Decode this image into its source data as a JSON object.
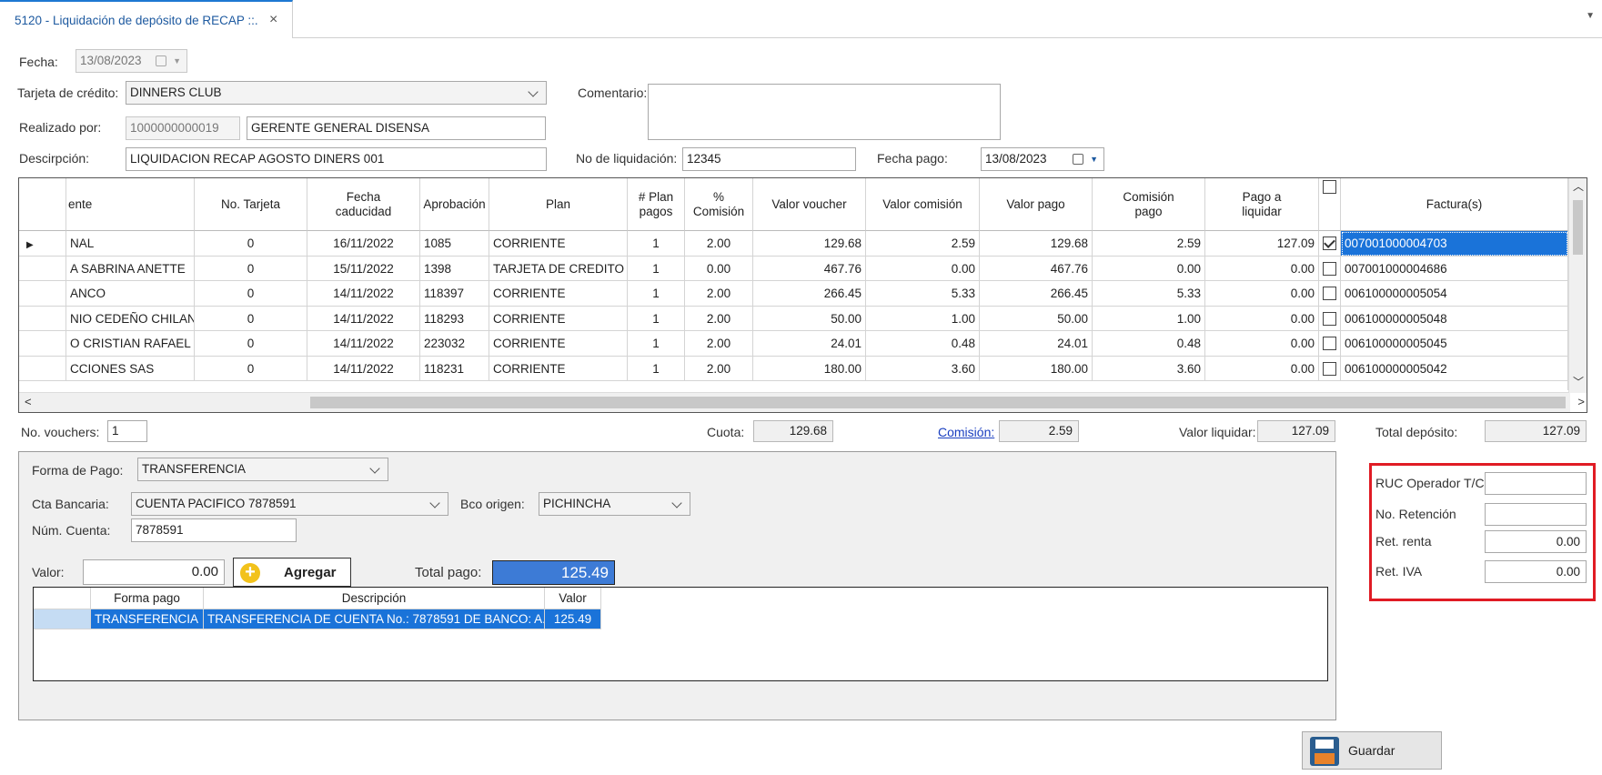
{
  "tab": {
    "title": "5120 - Liquidación de depósito de RECAP ::.",
    "close": "×",
    "menu": "▼"
  },
  "form": {
    "fecha_label": "Fecha:",
    "fecha_value": "13/08/2023",
    "tarjeta_label": "Tarjeta de crédito:",
    "tarjeta_value": "DINNERS CLUB",
    "comentario_label": "Comentario:",
    "comentario_value": "",
    "realizado_label": "Realizado por:",
    "realizado_code": "1000000000019",
    "realizado_name": "GERENTE GENERAL DISENSA",
    "descripcion_label": "Descirpción:",
    "descripcion_value": "LIQUIDACION RECAP AGOSTO DINERS 001",
    "liquidacion_label": "No de liquidación:",
    "liquidacion_value": "12345",
    "fecha_pago_label": "Fecha pago:",
    "fecha_pago_value": "13/08/2023"
  },
  "grid": {
    "headers": [
      "ente",
      "No. Tarjeta",
      "Fecha\ncaducidad",
      "Aprobación",
      "Plan",
      "# Plan\npagos",
      "%\nComisión",
      "Valor voucher",
      "Valor comisión",
      "Valor pago",
      "Comisión\npago",
      "Pago a\nliquidar",
      "",
      "Factura(s)"
    ],
    "rows": [
      [
        "NAL",
        "0",
        "16/11/2022",
        "1085",
        "CORRIENTE",
        "1",
        "2.00",
        "129.68",
        "2.59",
        "129.68",
        "2.59",
        "127.09",
        "007001000004703"
      ],
      [
        "A SABRINA  ANETTE",
        "0",
        "15/11/2022",
        "1398",
        "TARJETA DE CREDITO",
        "1",
        "0.00",
        "467.76",
        "0.00",
        "467.76",
        "0.00",
        "0.00",
        "007001000004686"
      ],
      [
        "ANCO",
        "0",
        "14/11/2022",
        "118397",
        "CORRIENTE",
        "1",
        "2.00",
        "266.45",
        "5.33",
        "266.45",
        "5.33",
        "0.00",
        "006100000005054"
      ],
      [
        "NIO CEDEÑO CHILAN",
        "0",
        "14/11/2022",
        "118293",
        "CORRIENTE",
        "1",
        "2.00",
        "50.00",
        "1.00",
        "50.00",
        "1.00",
        "0.00",
        "006100000005048"
      ],
      [
        "O CRISTIAN RAFAEL",
        "0",
        "14/11/2022",
        "223032",
        "CORRIENTE",
        "1",
        "2.00",
        "24.01",
        "0.48",
        "24.01",
        "0.48",
        "0.00",
        "006100000005045"
      ],
      [
        "CCIONES SAS",
        "0",
        "14/11/2022",
        "118231",
        "CORRIENTE",
        "1",
        "2.00",
        "180.00",
        "3.60",
        "180.00",
        "3.60",
        "0.00",
        "006100000005042"
      ]
    ],
    "checked": [
      true,
      false,
      false,
      false,
      false,
      false
    ],
    "selected_row": 0
  },
  "totals": {
    "vouchers_label": "No. vouchers:",
    "vouchers_value": "1",
    "cuota_label": "Cuota:",
    "cuota_value": "129.68",
    "comision_label": "Comisión:",
    "comision_value": "2.59",
    "valor_liquidar_label": "Valor liquidar:",
    "valor_liquidar_value": "127.09",
    "total_deposito_label": "Total depósito:",
    "total_deposito_value": "127.09"
  },
  "payment": {
    "forma_label": "Forma de Pago:",
    "forma_value": "TRANSFERENCIA",
    "cta_label": "Cta Bancaria:",
    "cta_value": "CUENTA PACIFICO 7878591",
    "bco_label": "Bco origen:",
    "bco_value": "PICHINCHA",
    "num_cuenta_label": "Núm. Cuenta:",
    "num_cuenta_value": "7878591",
    "valor_label": "Valor:",
    "valor_value": "0.00",
    "agregar_label": "Agregar",
    "total_pago_label": "Total pago:",
    "total_pago_value": "125.49",
    "grid_headers": [
      "Forma pago",
      "Descripción",
      "Valor"
    ],
    "grid_rows": [
      [
        "TRANSFERENCIA",
        "TRANSFERENCIA DE CUENTA No.: 7878591 DE BANCO: A...",
        "125.49"
      ]
    ]
  },
  "retention": {
    "ruc_label": "RUC Operador T/C",
    "ruc_value": "",
    "no_ret_label": "No. Retención",
    "no_ret_value": "",
    "ret_renta_label": "Ret. renta",
    "ret_renta_value": "0.00",
    "ret_iva_label": "Ret. IVA",
    "ret_iva_value": "0.00"
  },
  "actions": {
    "guardar_label": "Guardar"
  },
  "colors": {
    "accent": "#1e78d2",
    "selection": "#1a73d9",
    "highlight_box": "#e01b24"
  }
}
